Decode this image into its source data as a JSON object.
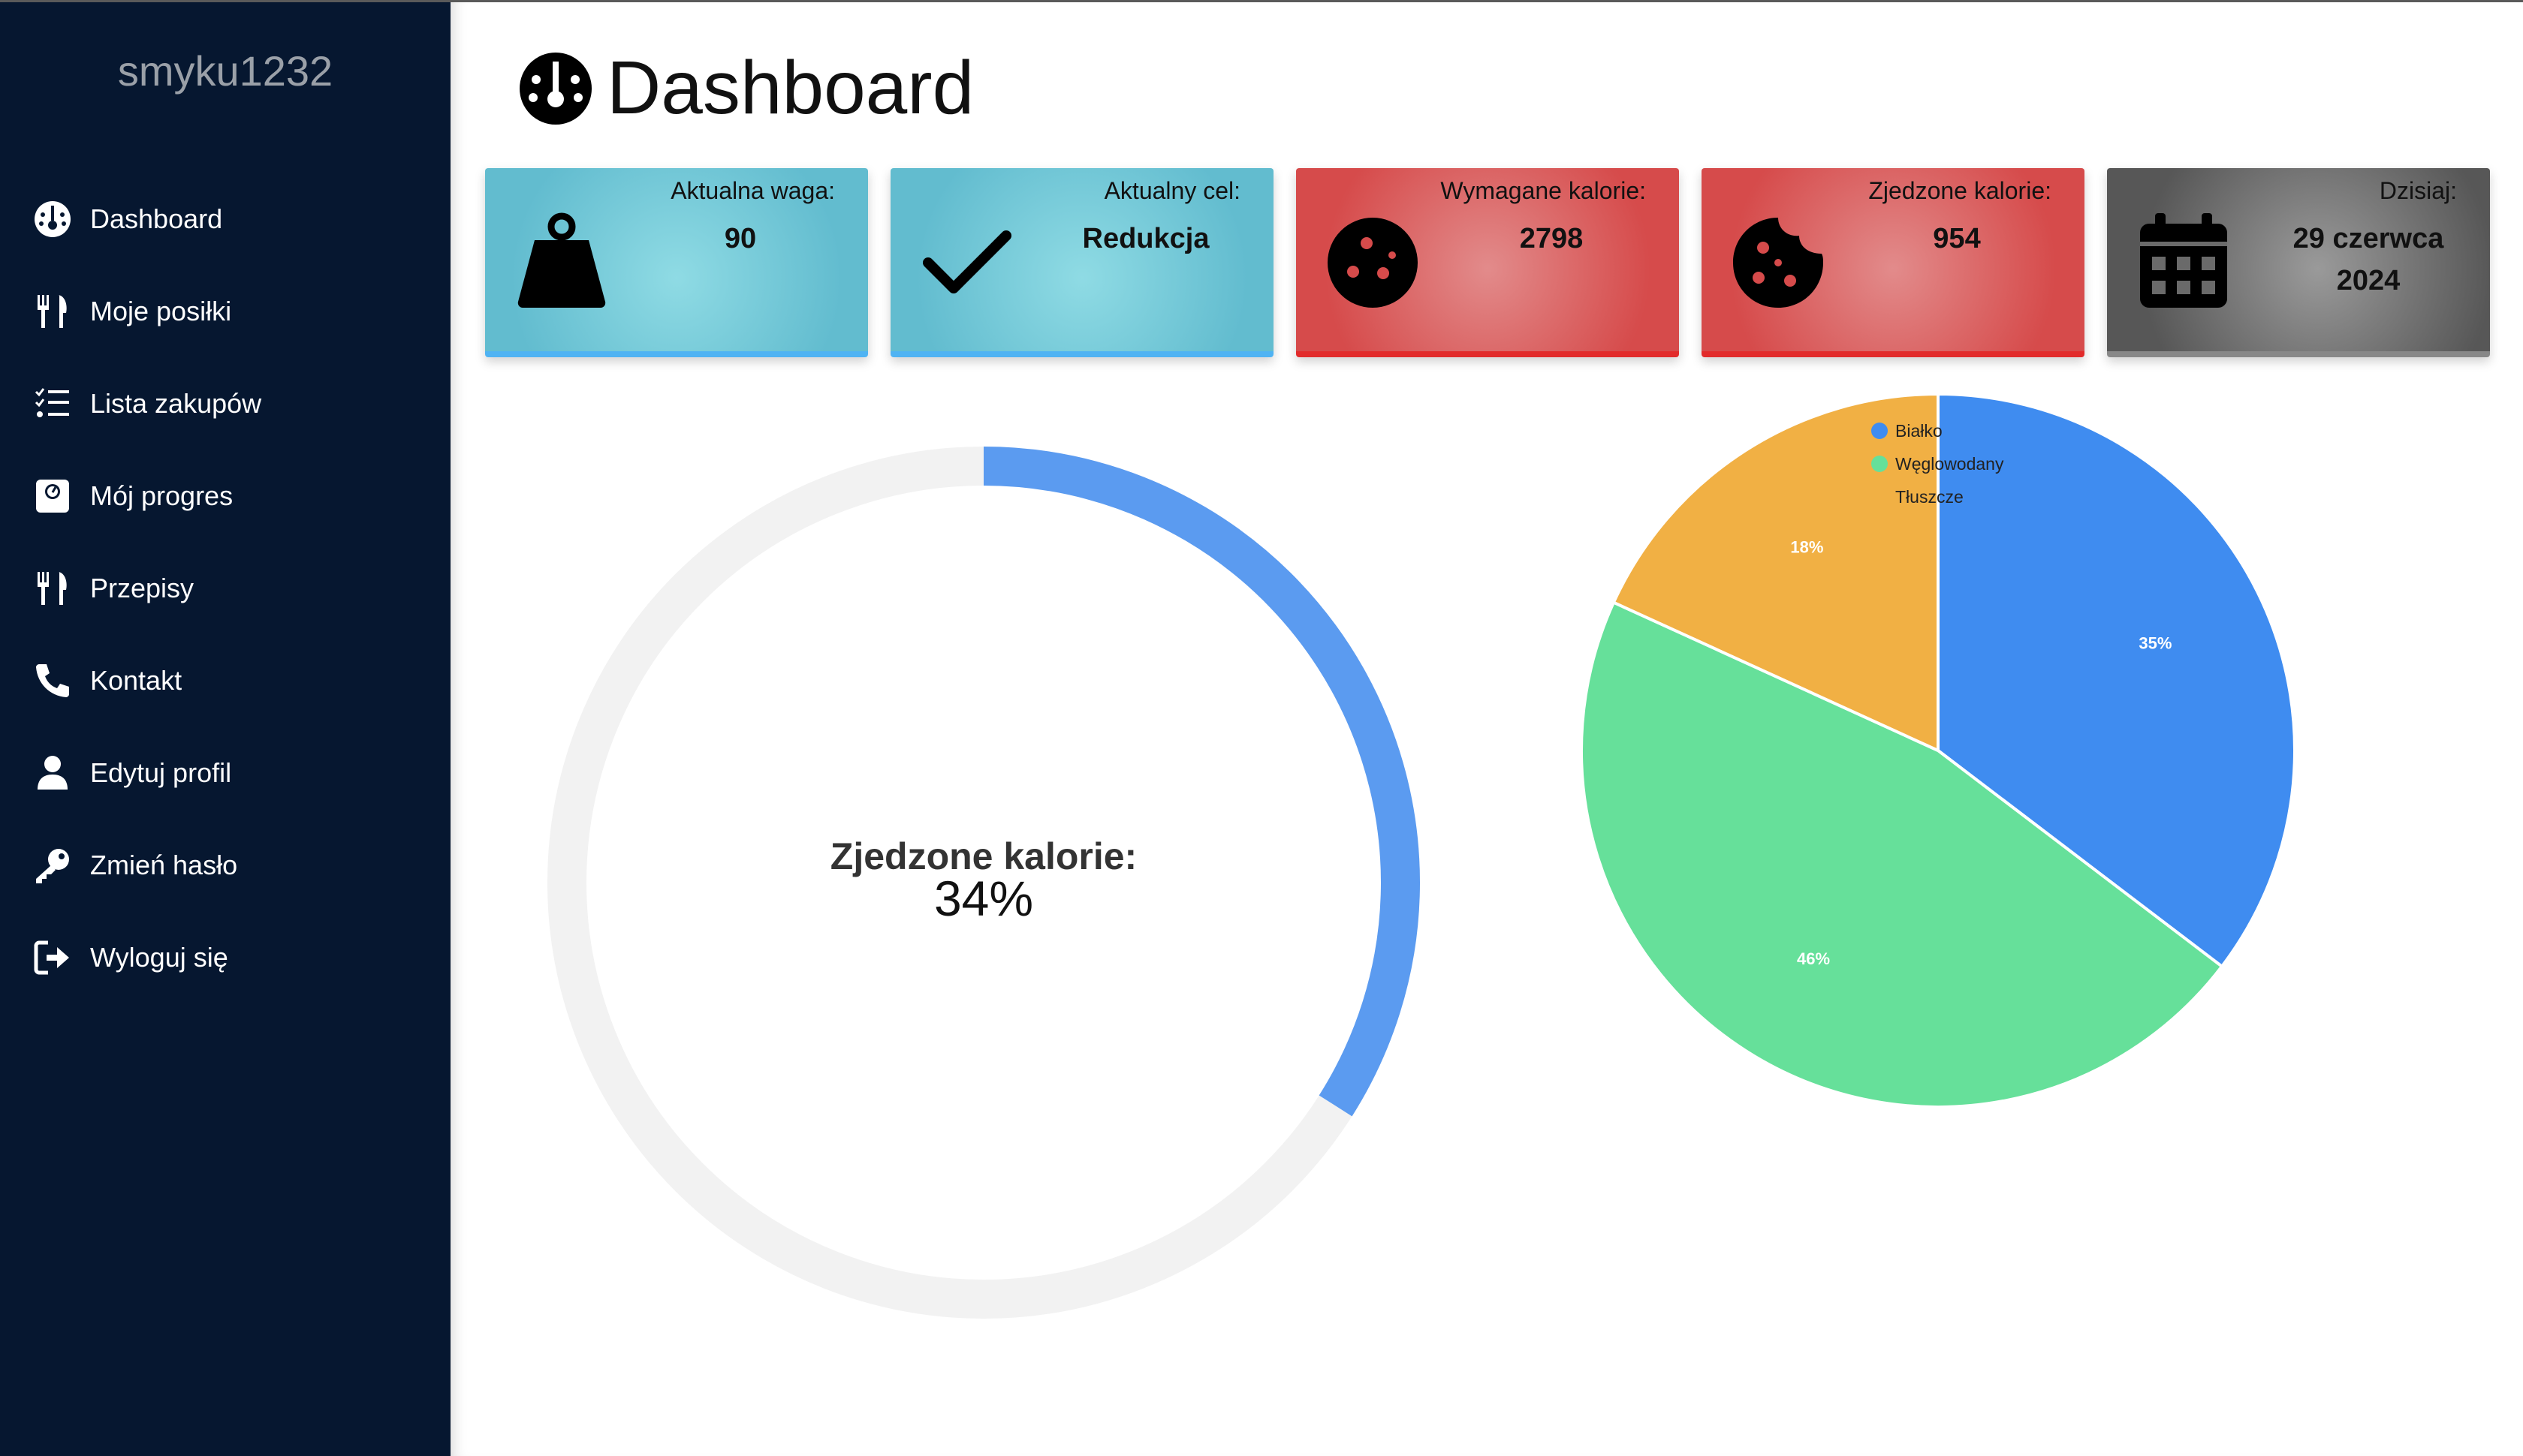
{
  "sidebar": {
    "username": "smyku1232",
    "items": [
      {
        "label": "Dashboard",
        "icon": "gauge-icon"
      },
      {
        "label": "Moje posiłki",
        "icon": "utensils-icon"
      },
      {
        "label": "Lista zakupów",
        "icon": "list-check-icon"
      },
      {
        "label": "Mój progres",
        "icon": "scale-icon"
      },
      {
        "label": "Przepisy",
        "icon": "utensils-icon"
      },
      {
        "label": "Kontakt",
        "icon": "phone-icon"
      },
      {
        "label": "Edytuj profil",
        "icon": "user-icon"
      },
      {
        "label": "Zmień hasło",
        "icon": "key-icon"
      },
      {
        "label": "Wyloguj się",
        "icon": "logout-icon"
      }
    ]
  },
  "header": {
    "title": "Dashboard",
    "icon": "gauge-icon"
  },
  "cards": [
    {
      "label": "Aktualna waga:",
      "value": "90",
      "icon": "weight-icon",
      "color": "#62bccf"
    },
    {
      "label": "Aktualny cel:",
      "value": "Redukcja",
      "icon": "check-icon",
      "color": "#62bccf"
    },
    {
      "label": "Wymagane kalorie:",
      "value": "2798",
      "icon": "cookie-icon",
      "color": "#d64b4b"
    },
    {
      "label": "Zjedzone kalorie:",
      "value": "954",
      "icon": "cookie-bite-icon",
      "color": "#d64b4b"
    },
    {
      "label": "Dzisiaj:",
      "value": "29 czerwca 2024",
      "icon": "calendar-icon",
      "color": "#575757"
    }
  ],
  "gauge": {
    "label": "Zjedzone kalorie:",
    "value_text": "34%",
    "fraction": 0.34,
    "fill_color": "#5b9bf0",
    "track_color": "#f2f2f2"
  },
  "chart_data": {
    "type": "pie",
    "categories": [
      "Białko",
      "Węglowodany",
      "Tłuszcze"
    ],
    "values": [
      35,
      46,
      18
    ],
    "labels": [
      "35%",
      "46%",
      "18%"
    ],
    "colors": [
      "#3f8cf0",
      "#66e09a",
      "#f1b044"
    ],
    "legend_position": "top-right"
  }
}
